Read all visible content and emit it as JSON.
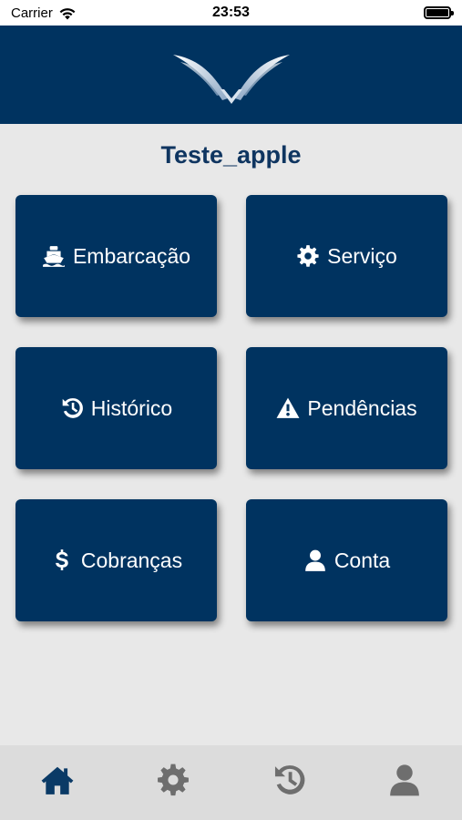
{
  "status_bar": {
    "carrier": "Carrier",
    "time": "23:53",
    "battery_level": 1.0
  },
  "header": {
    "logo_icon": "wings-v-logo"
  },
  "user": {
    "name": "Teste_apple"
  },
  "tiles": [
    {
      "label": "Embarcação",
      "icon": "ship-icon"
    },
    {
      "label": "Serviço",
      "icon": "gear-icon"
    },
    {
      "label": "Histórico",
      "icon": "history-icon"
    },
    {
      "label": "Pendências",
      "icon": "warning-icon"
    },
    {
      "label": "Cobranças",
      "icon": "dollar-icon"
    },
    {
      "label": "Conta",
      "icon": "user-icon"
    }
  ],
  "tab_bar": {
    "items": [
      {
        "icon": "home-icon",
        "active": true
      },
      {
        "icon": "gear-icon",
        "active": false
      },
      {
        "icon": "history-icon",
        "active": false
      },
      {
        "icon": "user-icon",
        "active": false
      }
    ]
  },
  "colors": {
    "brand_navy": "#003360",
    "title_navy": "#0f3560",
    "tab_active": "#0a3a66",
    "tab_inactive": "#6e6e6e",
    "background": "#e8e8e8"
  }
}
